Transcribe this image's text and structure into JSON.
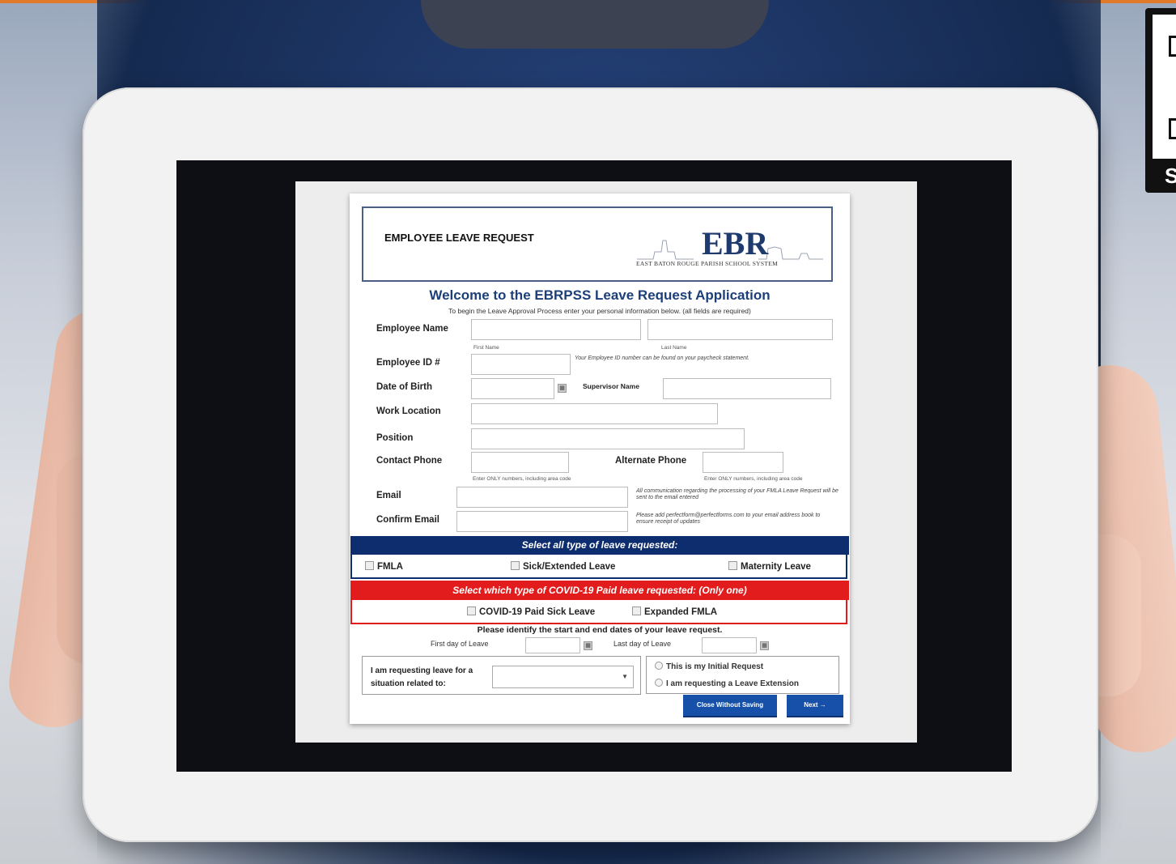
{
  "colors": {
    "top_strip": "#e07a2a",
    "form_blue": "#0d2d6e",
    "form_red": "#e21c1c",
    "heading_blue": "#1c3f7a",
    "button_blue": "#1650a8"
  },
  "header": {
    "title": "EMPLOYEE LEAVE REQUEST",
    "logo_text": "EBR",
    "logo_subtitle": "EAST BATON ROUGE PARISH SCHOOL SYSTEM"
  },
  "welcome": {
    "title": "Welcome to the EBRPSS Leave Request Application",
    "intro": "To begin the Leave Approval Process enter your personal information below. (all fields are required)"
  },
  "fields": {
    "employee_name": "Employee Name",
    "first_name_hint": "First Name",
    "last_name_hint": "Last Name",
    "employee_id": "Employee ID #",
    "employee_id_note": "Your Employee ID number can be found on your paycheck statement.",
    "dob": "Date of Birth",
    "supervisor": "Supervisor Name",
    "work_location": "Work Location",
    "position": "Position",
    "contact_phone": "Contact Phone",
    "alternate_phone": "Alternate Phone",
    "phone_hint": "Enter ONLY numbers, including area code",
    "email": "Email",
    "email_note": "All communication regarding the processing of your FMLA Leave Request will be sent to the email entered",
    "confirm_email": "Confirm Email",
    "confirm_note": "Please add perfectform@perfectforms.com to your email address book to ensure receipt of updates"
  },
  "leave_types": {
    "banner": "Select all type of leave requested:",
    "options": [
      "FMLA",
      "Sick/Extended Leave",
      "Maternity Leave"
    ]
  },
  "covid": {
    "banner": "Select which type of COVID-19 Paid leave requested: (Only one)",
    "options": [
      "COVID-19 Paid Sick Leave",
      "Expanded FMLA"
    ]
  },
  "dates": {
    "title": "Please identify the start and end dates of your leave request.",
    "first_day": "First day of Leave",
    "last_day": "Last day of Leave"
  },
  "situation": {
    "label": "I am requesting leave for a situation related to:",
    "select_value": ""
  },
  "request_type": {
    "options": [
      "This is my Initial Request",
      "I am requesting a Leave Extension"
    ]
  },
  "buttons": {
    "close": "Close Without Saving",
    "next": "Next →"
  },
  "icons": {
    "calendar": "calendar-icon",
    "dropdown": "chevron-down-icon"
  },
  "qr_banner": {
    "letter": "S"
  }
}
